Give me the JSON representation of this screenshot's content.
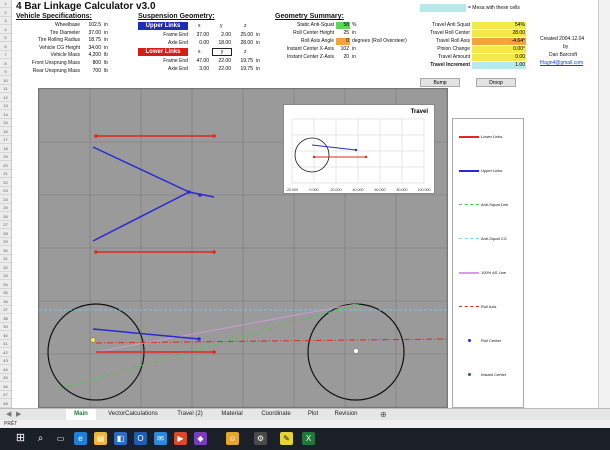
{
  "title": "4 Bar Linkage Calculator v3.0",
  "headers": {
    "vehicle": "Vehicle Specifications:",
    "suspension": "Suspension Geometry:",
    "summary": "Geometry Summary:"
  },
  "mesa_note": "= Mesa with these cells",
  "vehicle": [
    {
      "label": "Wheelbase",
      "value": "102.5",
      "unit": "in"
    },
    {
      "label": "Tire Diameter",
      "value": "37.00",
      "unit": "in"
    },
    {
      "label": "Tire Rolling Radius",
      "value": "18.75",
      "unit": "in"
    },
    {
      "label": "Vehicle CG Height",
      "value": "34.00",
      "unit": "in"
    },
    {
      "label": "Vehicle Mass",
      "value": "4,200",
      "unit": "lb"
    },
    {
      "label": "Front Unsprung Mass",
      "value": "800",
      "unit": "lb"
    },
    {
      "label": "Rear Unsprung Mass",
      "value": "700",
      "unit": "lb"
    }
  ],
  "upper_links": {
    "label": "Upper Links",
    "cols": [
      "x",
      "y",
      "z"
    ],
    "frame_end": {
      "label": "Frame End",
      "x": "37.00",
      "y": "2.00",
      "z": "25.00",
      "unit": "in"
    },
    "axle_end": {
      "label": "Axle End",
      "x": "0.00",
      "y": "18.00",
      "z": "28.00",
      "unit": "in"
    }
  },
  "lower_links": {
    "label": "Lower Links",
    "cols": [
      "x",
      "y",
      "z"
    ],
    "frame_end": {
      "label": "Frame End",
      "x": "47.00",
      "y": "22.00",
      "z": "19.75",
      "unit": "in"
    },
    "axle_end": {
      "label": "Axle End",
      "x": "3.00",
      "y": "22.00",
      "z": "19.75",
      "unit": "in"
    }
  },
  "summary": [
    {
      "label": "Static Anti-Squat",
      "value": "58",
      "unit": "%"
    },
    {
      "label": "Roll Center Height",
      "value": "25",
      "unit": "in"
    },
    {
      "label": "Roll Axis Angle",
      "value": "0",
      "unit": "degrees (Roll Oversteer)"
    },
    {
      "label": "Instant Center X-Axis",
      "value": "102",
      "unit": "in"
    },
    {
      "label": "Instant Center Z-Axis",
      "value": "20",
      "unit": "in"
    }
  ],
  "travel_summary": [
    {
      "label": "Travel Anti Squat",
      "value": "54%"
    },
    {
      "label": "Travel Roll Center",
      "value": "28.00"
    },
    {
      "label": "Travel Roll Axis",
      "value": "-4.64°"
    },
    {
      "label": "Pinion Change",
      "value": "0.00°"
    },
    {
      "label": "Travel Amount",
      "value": "0.00"
    },
    {
      "label": "Travel Increment",
      "value": "1.00"
    }
  ],
  "buttons": {
    "bump": "Bump",
    "droop": "Droop"
  },
  "credits": {
    "created": "Created 2004.12.04",
    "by": "by",
    "author": "Dan Barcroft",
    "email": "frlagn4@gmail.com"
  },
  "legend": [
    {
      "label": "Lower Links",
      "color": "#e0281c",
      "style": "solid-dots"
    },
    {
      "label": "Upper Links",
      "color": "#2a2ad6",
      "style": "solid-dots"
    },
    {
      "label": "Anti-Squat Line",
      "color": "#3fcf3f",
      "style": "dashed"
    },
    {
      "label": "Anti-Squat CG",
      "color": "#69d6ff",
      "style": "dashed"
    },
    {
      "label": "100% AS Line",
      "color": "#d99be6",
      "style": "solid"
    },
    {
      "label": "Roll Axis",
      "color": "#e0281c",
      "style": "dash-dot"
    },
    {
      "label": "Roll Center",
      "color": "#2a2ad6",
      "style": "point"
    },
    {
      "label": "Instant Center",
      "color": "#1a7a1a",
      "style": "point"
    }
  ],
  "travel_chart": {
    "title": "Travel",
    "x_ticks": [
      "-20.000",
      "0.000",
      "20.000",
      "40.000",
      "60.000",
      "80.000",
      "100.000"
    ]
  },
  "row_numbers": [
    "1",
    "2",
    "3",
    "4",
    "5",
    "6",
    "7",
    "8",
    "9",
    "10",
    "11",
    "12",
    "13",
    "14",
    "15",
    "16",
    "17",
    "18",
    "19",
    "20",
    "21",
    "22",
    "23",
    "24",
    "25",
    "26",
    "27",
    "28",
    "29",
    "30",
    "31",
    "32",
    "33",
    "34",
    "35",
    "36",
    "37",
    "38",
    "39",
    "40",
    "41",
    "42",
    "43",
    "44",
    "45",
    "46",
    "47",
    "48"
  ],
  "tabs": [
    "Main",
    "VectorCalculations",
    "Travel (2)",
    "Material",
    "Coordinate",
    "Plot",
    "Revision"
  ],
  "active_tab": "Main",
  "status": "PRÊT",
  "colors": {
    "green_cell": "#63d45a",
    "orange_cell": "#f2a33a",
    "yellow_cell": "#f5e84a",
    "mesa": "#b8e8ea",
    "accent": "#1e7b3a"
  }
}
